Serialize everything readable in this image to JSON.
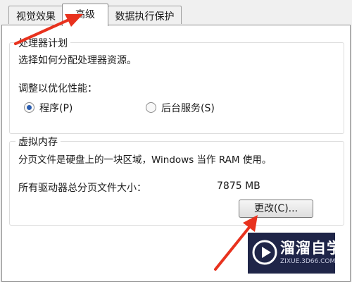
{
  "tabs": [
    {
      "label": "视觉效果"
    },
    {
      "label": "高级"
    },
    {
      "label": "数据执行保护"
    }
  ],
  "processor_scheduling": {
    "title": "处理器计划",
    "description": "选择如何分配处理器资源。",
    "adjust_label": "调整以优化性能：",
    "options": [
      {
        "label": "程序(P)",
        "checked": true
      },
      {
        "label": "后台服务(S)",
        "checked": false
      }
    ]
  },
  "virtual_memory": {
    "title": "虚拟内存",
    "description": "分页文件是硬盘上的一块区域，Windows 当作 RAM 使用。",
    "total_label": "所有驱动器总分页文件大小：",
    "total_value": "7875 MB",
    "change_button": "更改(C)..."
  },
  "watermark": {
    "title": "溜溜自学",
    "subtitle": "ZIXUE.3D66.COM"
  },
  "colors": {
    "arrow": "#e8321e",
    "radio_selected": "#2a5db0",
    "watermark_bg": "#1f2548"
  }
}
